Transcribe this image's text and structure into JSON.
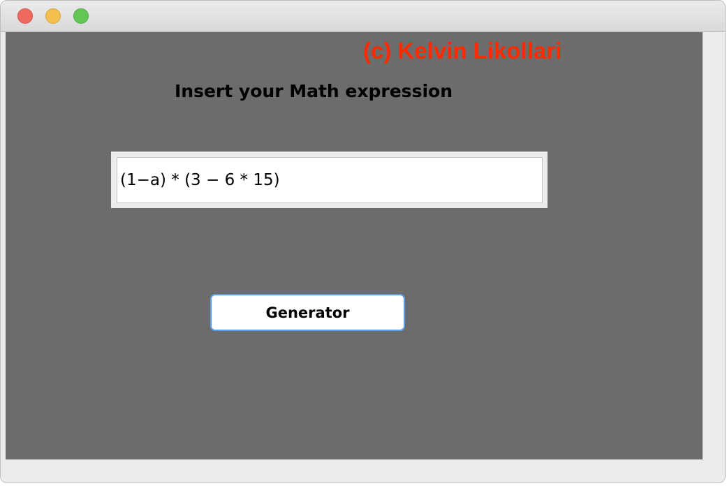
{
  "window": {
    "controls": {
      "close_color": "#ee6a5e",
      "minimize_color": "#f5bf4f",
      "zoom_color": "#62c655"
    }
  },
  "main": {
    "copyright": "(c) Kelvin Likollari",
    "copyright_color": "#ff2a00",
    "heading": "Insert your Math expression",
    "expression_input": {
      "value": "(1−a) * (3 − 6 * 15)"
    },
    "generator_button_label": "Generator",
    "background_color": "#6c6c6c"
  }
}
